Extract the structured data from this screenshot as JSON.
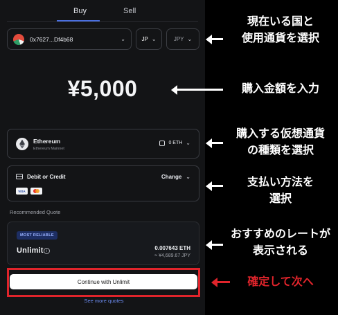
{
  "tabs": [
    {
      "label": "Buy",
      "active": true
    },
    {
      "label": "Sell",
      "active": false
    }
  ],
  "wallet": {
    "address": "0x7627...Df4b68"
  },
  "country": {
    "value": "JP"
  },
  "currency": {
    "value": "JPY"
  },
  "amount": {
    "value": "¥5,000"
  },
  "token": {
    "name": "Ethereum",
    "network": "Ethereum Mainnet",
    "balance": "0 ETH"
  },
  "payment": {
    "method": "Debit or Credit",
    "change_label": "Change",
    "cards": [
      "VISA",
      "Mastercard"
    ]
  },
  "recommended_label": "Recommended Quote",
  "quote": {
    "badge": "MOST RELIABLE",
    "provider": "Unlimit",
    "crypto_amount": "0.007643 ETH",
    "fiat_amount": "≈ ¥4,689.67 JPY"
  },
  "continue_label": "Continue with Unlimit",
  "see_more_label": "See more quotes",
  "annotations": {
    "country_currency": [
      "現在いる国と",
      "使用通貨を選択"
    ],
    "amount": [
      "購入金額を入力"
    ],
    "token": [
      "購入する仮想通貨",
      "の種類を選択"
    ],
    "payment": [
      "支払い方法を",
      "選択"
    ],
    "quote": [
      "おすすめのレートが",
      "表示される"
    ],
    "confirm": [
      "確定して次へ"
    ]
  },
  "colors": {
    "background": "#000000",
    "panel": "#131416",
    "accent": "#4a6fe0",
    "highlight": "#e0242b",
    "link": "#6c8cf0"
  }
}
